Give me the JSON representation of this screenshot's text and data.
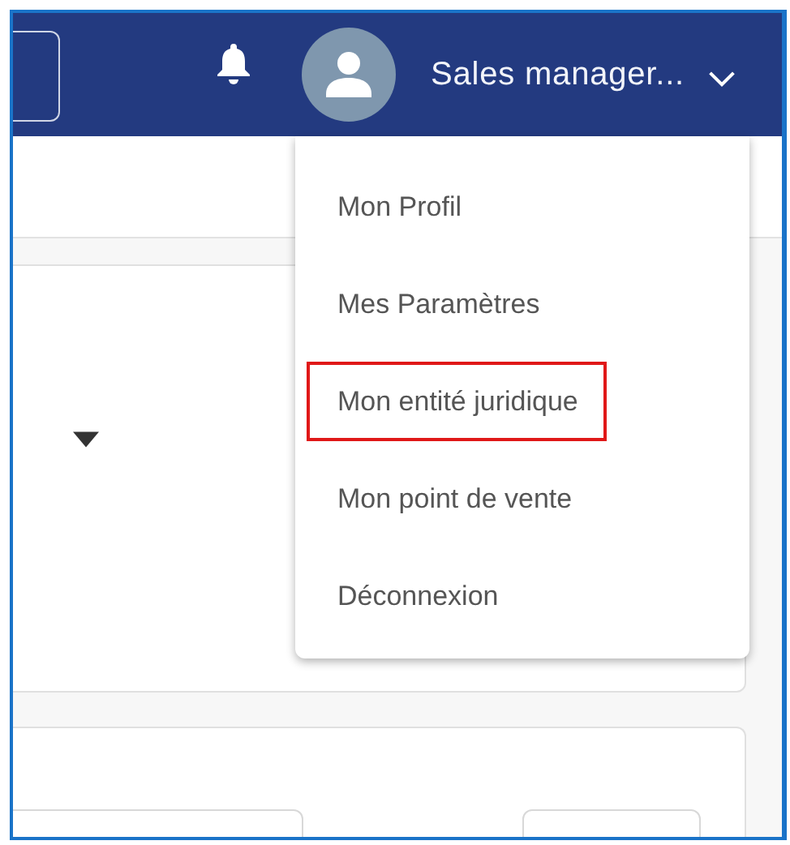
{
  "header": {
    "user_name": "Sales manager..."
  },
  "user_menu": {
    "items": [
      {
        "label": "Mon Profil",
        "highlighted": false
      },
      {
        "label": "Mes Paramètres",
        "highlighted": false
      },
      {
        "label": "Mon entité juridique",
        "highlighted": true
      },
      {
        "label": "Mon point de vente",
        "highlighted": false
      },
      {
        "label": "Déconnexion",
        "highlighted": false
      }
    ]
  }
}
